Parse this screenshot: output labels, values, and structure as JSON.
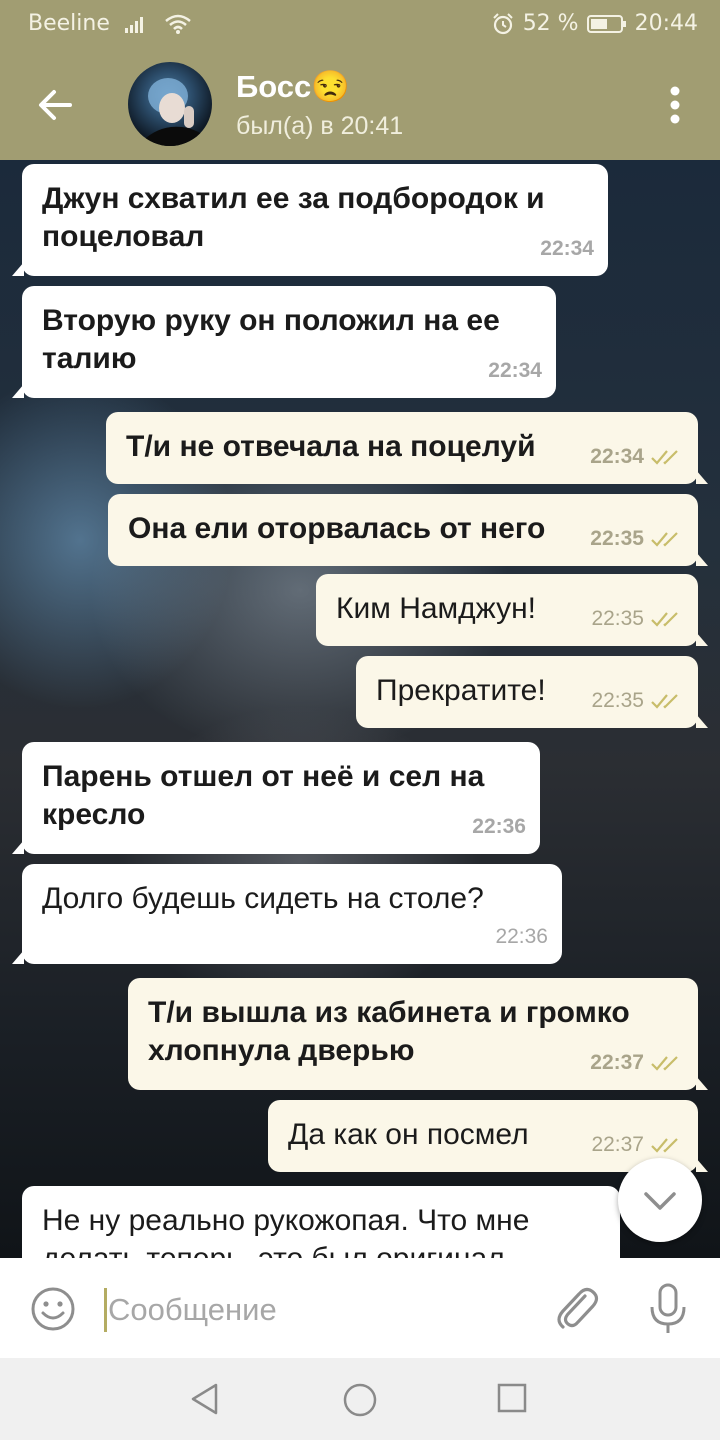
{
  "status_bar": {
    "carrier": "Beeline",
    "battery": "52 %",
    "time": "20:44"
  },
  "header": {
    "title": "Босс😒",
    "status": "был(а) в 20:41"
  },
  "messages": [
    {
      "text": "Джун схватил ее за подбородок и поцеловал",
      "time": "22:34",
      "direction": "in",
      "bold": true
    },
    {
      "text": "Вторую руку он положил на ее талию",
      "time": "22:34",
      "direction": "in",
      "bold": true
    },
    {
      "text": "Т/и не отвечала на поцелуй",
      "time": "22:34",
      "direction": "out",
      "bold": true
    },
    {
      "text": "Она ели оторвалась от него",
      "time": "22:35",
      "direction": "out",
      "bold": true
    },
    {
      "text": "Ким Намджун!",
      "time": "22:35",
      "direction": "out",
      "bold": false
    },
    {
      "text": "Прекратите!",
      "time": "22:35",
      "direction": "out",
      "bold": false
    },
    {
      "text": "Парень отшел от неё и сел на кресло",
      "time": "22:36",
      "direction": "in",
      "bold": true
    },
    {
      "text": "Долго будешь сидеть на столе?",
      "time": "22:36",
      "direction": "in",
      "bold": false
    },
    {
      "text": "Т/и вышла из кабинета и громко хлопнула дверью",
      "time": "22:37",
      "direction": "out",
      "bold": true
    },
    {
      "text": "Да как он посмел",
      "time": "22:37",
      "direction": "out",
      "bold": false
    },
    {
      "text": "Не ну реально рукожопая. Что мне делать теперь, это был оригинал",
      "time": "",
      "direction": "in",
      "bold": false
    }
  ],
  "composer": {
    "placeholder": "Сообщение"
  },
  "colors": {
    "header": "#a19d72",
    "outgoing_bubble": "#fbf7e8",
    "incoming_bubble": "#ffffff",
    "read_checks": "#c8bd6a"
  },
  "icons": [
    "back-arrow-icon",
    "more-vertical-icon",
    "chevron-down-icon",
    "emoji-icon",
    "paperclip-icon",
    "microphone-icon",
    "nav-back-icon",
    "nav-home-icon",
    "nav-recents-icon"
  ]
}
